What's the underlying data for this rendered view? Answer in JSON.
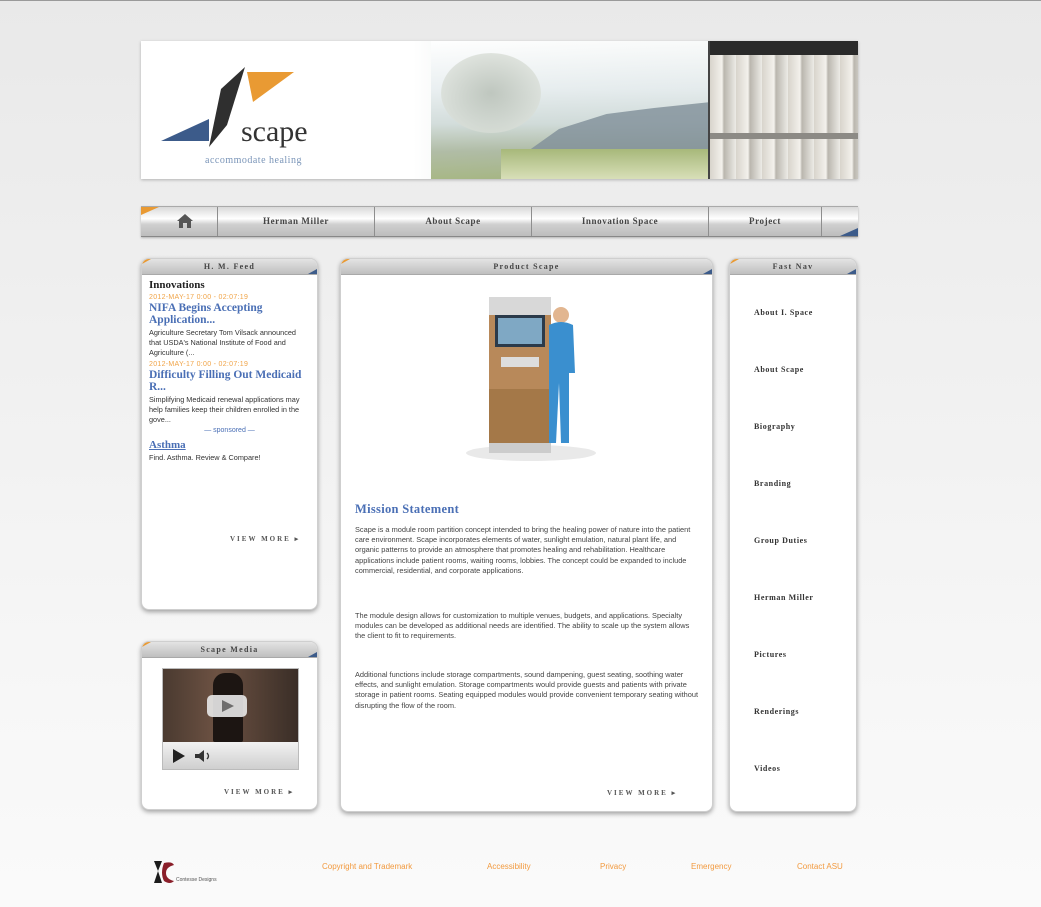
{
  "brand": {
    "wordmark": "scape",
    "tagline": "accommodate healing",
    "colors": {
      "orange": "#e99a33",
      "blue": "#3c5b8a",
      "link": "#4a6fb5"
    }
  },
  "nav": {
    "home_icon": "home-icon",
    "items": [
      "Herman Miller",
      "About Scape",
      "Innovation Space",
      "Project"
    ]
  },
  "news_panel": {
    "title": "H. M. Feed",
    "section": "Innovations",
    "items": [
      {
        "date": "2012-MAY-17 0:00 - 02:07:19",
        "headline": "NIFA Begins Accepting Application...",
        "body": "Agriculture Secretary Tom Vilsack announced that USDA's National Institute of Food and Agriculture (..."
      },
      {
        "date": "2012-MAY-17 0:00 - 02:07:19",
        "headline": "Difficulty Filling Out Medicaid R...",
        "body": "Simplifying Medicaid renewal applications may help families keep their children enrolled in the gove..."
      }
    ],
    "separator": "— sponsored —",
    "asthma_title": "Asthma",
    "asthma_body": "Find. Asthma. Review & Compare!",
    "view_more": "VIEW MORE ▸"
  },
  "media_panel": {
    "title": "Scape Media",
    "view_more": "VIEW MORE ▸"
  },
  "product_panel": {
    "title": "Product Scape",
    "mission_title": "Mission Statement",
    "paragraphs": [
      "Scape is a module room partition concept intended to bring the healing power of nature into the patient care environment. Scape incorporates elements of water, sunlight emulation, natural plant life, and organic patterns to provide an atmosphere that promotes healing and rehabilitation. Healthcare applications include patient rooms, waiting rooms, lobbies. The concept could be expanded to include commercial, residential, and corporate applications.",
      "The module design allows for customization to multiple venues, budgets, and applications. Specialty modules can be developed as additional needs are identified. The ability to scale up the system allows the client to fit to requirements.",
      "Additional functions include storage compartments, sound dampening, guest seating, soothing water effects, and sunlight emulation. Storage compartments would provide guests and patients with private storage in patient rooms. Seating equipped modules would provide convenient temporary seating without disrupting the flow of the room."
    ],
    "view_more": "VIEW MORE ▸"
  },
  "fast_nav": {
    "title": "Fast Nav",
    "items": [
      "About I. Space",
      "About Scape",
      "Biography",
      "Branding",
      "Group Duties",
      "Herman Miller",
      "Pictures",
      "Renderings",
      "Videos"
    ]
  },
  "footer": {
    "logo_text": "Contesse Designs",
    "links": [
      "Copyright and Trademark",
      "Accessibility",
      "Privacy",
      "Emergency",
      "Contact ASU"
    ]
  }
}
